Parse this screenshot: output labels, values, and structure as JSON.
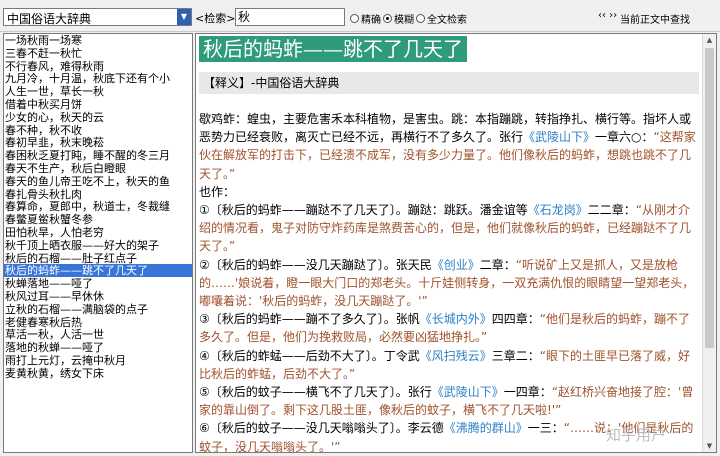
{
  "toolbar": {
    "dict_name": "中国俗语大辞典",
    "search_label": "<检索>",
    "search_value": "秋",
    "radio_exact": "精确",
    "radio_fuzzy": "模糊",
    "radio_fulltext": "全文检索",
    "nav_arrows": "‹‹ ››",
    "find_in_text": "当前正文中查找"
  },
  "entries": [
    "一场秋雨一场寒",
    "三春不赶一秋忙",
    "不行春风，难得秋雨",
    "九月冷，十月温，秋底下还有个小",
    "人生一世，草长一秋",
    "借着中秋买月饼",
    "少女的心，秋天的云",
    "春不种，秋不收",
    "春初早韭，秋末晚菘",
    "春困秋乏夏打盹，睡不醒的冬三月",
    "春天不生产，秋后白瞪眼",
    "春天的鱼儿帝王吃不上，秋天的鱼",
    "春扎骨头秋扎肉",
    "春算命，夏郎中，秋道士，冬裁缝",
    "春鳖夏鲎秋蟹冬参",
    "田怕秋旱，人怕老穷",
    "秋千顶上晒衣服——好大的架子",
    "秋后的石榴——肚子红点子",
    "秋后的蚂蚱——跳不了几天了",
    "秋蝉落地——哑了",
    "秋风过耳——早休休",
    "立秋的石榴——满脑袋的点子",
    "老健春寒秋后热",
    "草活一秋，人活一世",
    "落地的秋蝉——哑了",
    "雨打上元灯，云掩中秋月",
    "麦黄秋黄，绣女下床"
  ],
  "selected_index": 18,
  "article": {
    "headline": "秋后的蚂蚱——跳不了几天了",
    "source": "【释义】-中国俗语大辞典",
    "paragraphs": [
      [
        {
          "t": "歇鸡蚱：蝗虫，主要危害禾本科植物，是害虫。跳：本指蹦跳，转指挣扎、横行等。指坏人或恶势力已经衰败，离灭亡已经不远，再横行不了多久了。张行"
        },
        {
          "t": "《武陵山下》",
          "c": "lnk"
        },
        {
          "t": "一章六○："
        },
        {
          "t": "“这帮家伙在解放军的打击下，已经溃不成军，没有多少力量了。他们像秋后的蚂蚱，想跳也跳不了几天了。”",
          "c": "quote"
        }
      ],
      [
        {
          "t": "也作："
        }
      ],
      [
        {
          "t": "①〔秋后的蚂蚱——蹦跶不了几天了〕。蹦跶：跳跃。潘金谊等"
        },
        {
          "t": "《石龙岗》",
          "c": "lnk"
        },
        {
          "t": "二二章："
        },
        {
          "t": "“从刚才介绍的情况看，鬼子对防守炸药库是煞费苦心的，但是，他们就像秋后的蚂蚱，已经蹦跶不了几天了。”",
          "c": "quote"
        }
      ],
      [
        {
          "t": "②〔秋后的蚂蚱——没几天蹦跶了〕。张天民"
        },
        {
          "t": "《创业》",
          "c": "lnk"
        },
        {
          "t": "二章："
        },
        {
          "t": "“听说矿上又是抓人，又是放枪的……'娘说着，瞪一眼大门口的郑老头。十斤娃侧转身，一双充满仇恨的眼睛望一望郑老头，嘟囔着说：'秋后的蚂蚱，没几天蹦跶了。'”",
          "c": "quote"
        }
      ],
      [
        {
          "t": "③〔秋后的蚂蚱——蹦不了多久了〕。张帆"
        },
        {
          "t": "《长城内外》",
          "c": "lnk"
        },
        {
          "t": "四四章："
        },
        {
          "t": "“他们是秋后的蚂蚱，蹦不了多久了。但是，他们为挽救败局，必然要凶猛地挣扎。”",
          "c": "quote"
        }
      ],
      [
        {
          "t": "④〔秋后的蚱蜢——后劲不大了〕。丁令武"
        },
        {
          "t": "《风扫残云》",
          "c": "lnk"
        },
        {
          "t": "三章二："
        },
        {
          "t": "“眼下的土匪早已落了威，好比秋后的蚱蜢，后劲不大了。”",
          "c": "quote"
        }
      ],
      [
        {
          "t": "⑤〔秋后的蚊子——横飞不了几天了〕。张行"
        },
        {
          "t": "《武陵山下》",
          "c": "lnk"
        },
        {
          "t": "一四章："
        },
        {
          "t": "“赵红桥兴奋地接了腔：'曾家的靠山倒了。剩下这几股土匪，像秋后的蚊子，横飞不了几天啦!'”",
          "c": "quote"
        }
      ],
      [
        {
          "t": "⑥〔秋后的蚊子——没几天嗡嗡头了〕。李云德"
        },
        {
          "t": "《沸腾的群山》",
          "c": "lnk"
        },
        {
          "t": "一三："
        },
        {
          "t": "“……说：'他们是秋后的蚊子，没几天嗡嗡头了。'”",
          "c": "quote"
        }
      ]
    ]
  },
  "watermark": "知乎用户"
}
